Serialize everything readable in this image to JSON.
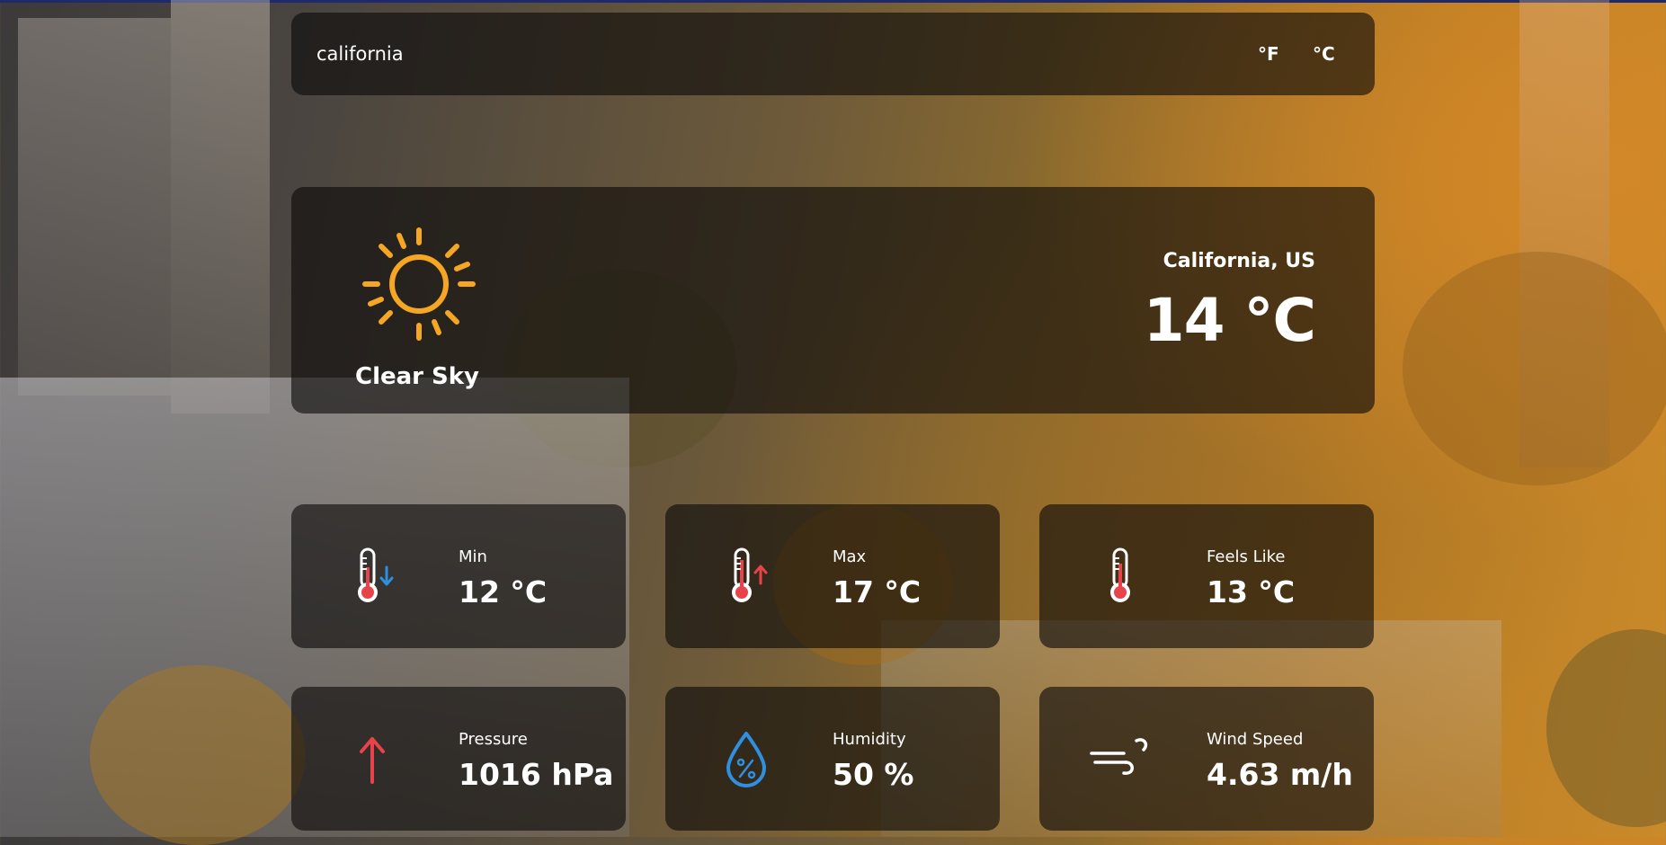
{
  "search": {
    "value": "california"
  },
  "units": {
    "fahrenheit": "°F",
    "celsius": "°C"
  },
  "current": {
    "condition": "Clear Sky",
    "location": "California, US",
    "temperature": "14 °C",
    "icon": "sun-icon"
  },
  "stats": [
    {
      "label": "Min",
      "value": "12 °C",
      "icon": "thermometer-down-icon"
    },
    {
      "label": "Max",
      "value": "17 °C",
      "icon": "thermometer-up-icon"
    },
    {
      "label": "Feels Like",
      "value": "13 °C",
      "icon": "thermometer-icon"
    },
    {
      "label": "Pressure",
      "value": "1016 hPa",
      "icon": "arrow-up-icon"
    },
    {
      "label": "Humidity",
      "value": "50 %",
      "icon": "humidity-drop-icon"
    },
    {
      "label": "Wind Speed",
      "value": "4.63 m/h",
      "icon": "wind-icon"
    }
  ],
  "colors": {
    "sun": "#f5a623",
    "thermo_red": "#e8434a",
    "arrow_blue": "#2f8fe0",
    "pressure_red": "#e8434a",
    "humidity_blue": "#2f8fe0"
  }
}
